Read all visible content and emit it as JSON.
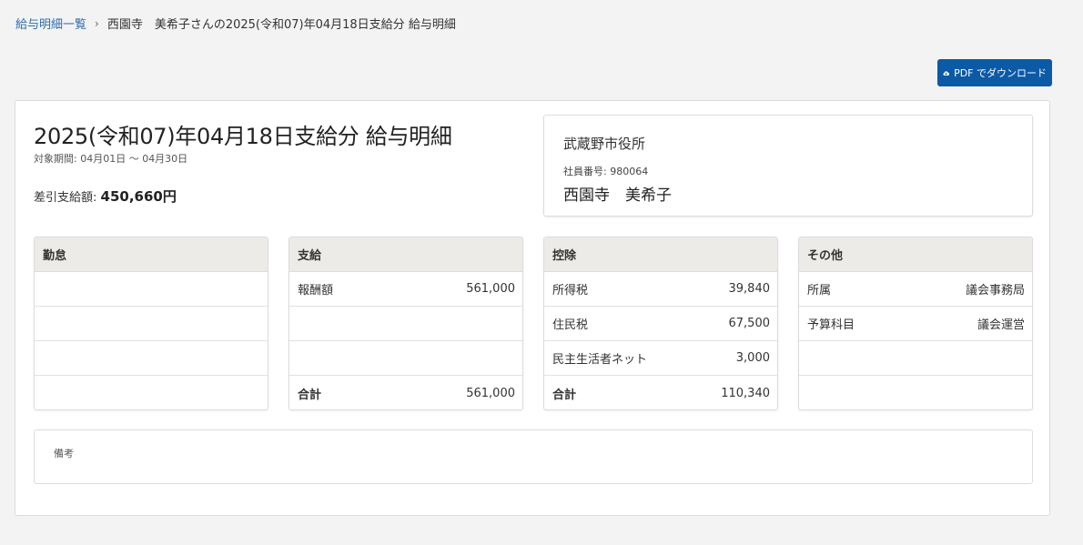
{
  "breadcrumb": {
    "list_link": "給与明細一覧",
    "separator": "›",
    "current": "西園寺　美希子さんの2025(令和07)年04月18日支給分 給与明細"
  },
  "toolbar": {
    "pdf_label": "PDF でダウンロード",
    "accent_color": "#0b5aa6"
  },
  "statement": {
    "title": "2025(令和07)年04月18日支給分 給与明細",
    "period": "対象期間: 04月01日 〜 04月30日",
    "net_pay_label": "差引支給額: ",
    "net_pay_amount": "450,660円"
  },
  "employer": {
    "name": "武蔵野市役所",
    "employee_id": "社員番号: 980064",
    "employee_name": "西園寺　美希子"
  },
  "panels": [
    {
      "header": "勤怠",
      "rows": [
        {
          "label": "",
          "value": ""
        },
        {
          "label": "",
          "value": ""
        },
        {
          "label": "",
          "value": ""
        },
        {
          "label": "",
          "value": ""
        }
      ]
    },
    {
      "header": "支給",
      "rows": [
        {
          "label": "報酬額",
          "value": "561,000"
        },
        {
          "label": "",
          "value": ""
        },
        {
          "label": "",
          "value": ""
        },
        {
          "label": "合計",
          "value": "561,000"
        }
      ]
    },
    {
      "header": "控除",
      "rows": [
        {
          "label": "所得税",
          "value": "39,840"
        },
        {
          "label": "住民税",
          "value": "67,500"
        },
        {
          "label": "民主生活者ネット",
          "value": "3,000"
        },
        {
          "label": "合計",
          "value": "110,340"
        }
      ]
    },
    {
      "header": "その他",
      "rows": [
        {
          "label": "所属",
          "value": "議会事務局"
        },
        {
          "label": "予算科目",
          "value": "議会運営"
        },
        {
          "label": "",
          "value": ""
        },
        {
          "label": "",
          "value": ""
        }
      ]
    }
  ],
  "remarks": {
    "label": "備考"
  }
}
